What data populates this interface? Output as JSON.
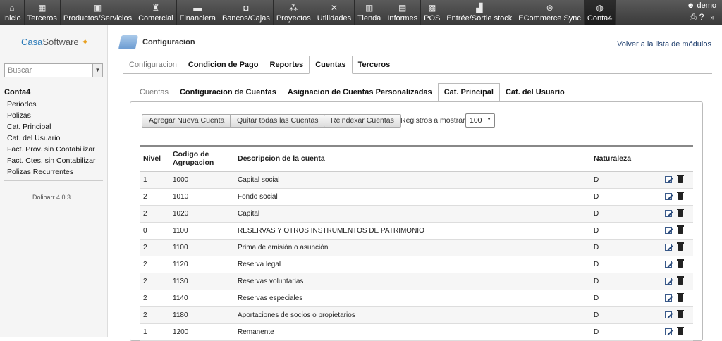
{
  "topbar": {
    "items": [
      {
        "label": "Inicio",
        "icon": "home-icon",
        "glyph": "⌂"
      },
      {
        "label": "Terceros",
        "icon": "building-icon",
        "glyph": "▦"
      },
      {
        "label": "Productos/Servicios",
        "icon": "boxes-icon",
        "glyph": "▣"
      },
      {
        "label": "Comercial",
        "icon": "briefcase-icon",
        "glyph": "♜"
      },
      {
        "label": "Financiera",
        "icon": "money-icon",
        "glyph": "▬"
      },
      {
        "label": "Bancos/Cajas",
        "icon": "bank-icon",
        "glyph": "◘"
      },
      {
        "label": "Proyectos",
        "icon": "project-icon",
        "glyph": "⁂"
      },
      {
        "label": "Utilidades",
        "icon": "tools-icon",
        "glyph": "✕"
      },
      {
        "label": "Tienda",
        "icon": "store-icon",
        "glyph": "▥"
      },
      {
        "label": "Informes",
        "icon": "report-icon",
        "glyph": "▤"
      },
      {
        "label": "POS",
        "icon": "register-icon",
        "glyph": "▩"
      },
      {
        "label": "Entrée/Sortie stock",
        "icon": "forklift-icon",
        "glyph": "▟"
      },
      {
        "label": "ECommerce Sync",
        "icon": "database-icon",
        "glyph": "⊜"
      },
      {
        "label": "Conta4",
        "icon": "globe-icon",
        "glyph": "◍",
        "active": true
      }
    ],
    "user": "demo"
  },
  "sidebar": {
    "logo_a": "Casa",
    "logo_b": "Software",
    "search_placeholder": "Buscar",
    "menu_title": "Conta4",
    "menu_items": [
      "Periodos",
      "Polizas",
      "Cat. Principal",
      "Cat. del Usuario",
      "Fact. Prov. sin Contabilizar",
      "Fact. Ctes. sin Contabilizar",
      "Polizas Recurrentes"
    ],
    "version": "Dolibarr 4.0.3"
  },
  "page": {
    "title": "Configuracion",
    "back_link": "Volver a la lista de módulos"
  },
  "tabs1": [
    "Configuracion",
    "Condicion de Pago",
    "Reportes",
    "Cuentas",
    "Terceros"
  ],
  "tabs2": [
    "Cuentas",
    "Configuracion de Cuentas",
    "Asignacion de Cuentas Personalizadas",
    "Cat. Principal",
    "Cat. del Usuario"
  ],
  "toolbar": {
    "add": "Agregar Nueva Cuenta",
    "remove_all": "Quitar todas las Cuentas",
    "reindex": "Reindexar Cuentas",
    "show_label": "Registros a mostrar:",
    "show_value": "100"
  },
  "table": {
    "headers": {
      "nivel": "Nivel",
      "codigo": "Codigo de Agrupacion",
      "desc": "Descripcion de la cuenta",
      "nat": "Naturaleza"
    },
    "rows": [
      {
        "nivel": "1",
        "codigo": "1000",
        "desc": "Capital social",
        "nat": "D"
      },
      {
        "nivel": "2",
        "codigo": "1010",
        "desc": "Fondo social",
        "nat": "D"
      },
      {
        "nivel": "2",
        "codigo": "1020",
        "desc": "Capital",
        "nat": "D"
      },
      {
        "nivel": "0",
        "codigo": "1100",
        "desc": "RESERVAS Y OTROS INSTRUMENTOS DE PATRIMONIO",
        "nat": "D"
      },
      {
        "nivel": "2",
        "codigo": "1100",
        "desc": "Prima de emisión o asunción",
        "nat": "D"
      },
      {
        "nivel": "2",
        "codigo": "1120",
        "desc": "Reserva legal",
        "nat": "D"
      },
      {
        "nivel": "2",
        "codigo": "1130",
        "desc": "Reservas voluntarias",
        "nat": "D"
      },
      {
        "nivel": "2",
        "codigo": "1140",
        "desc": "Reservas especiales",
        "nat": "D"
      },
      {
        "nivel": "2",
        "codigo": "1180",
        "desc": "Aportaciones de socios o propietarios",
        "nat": "D"
      },
      {
        "nivel": "1",
        "codigo": "1200",
        "desc": "Remanente",
        "nat": "D"
      }
    ]
  }
}
